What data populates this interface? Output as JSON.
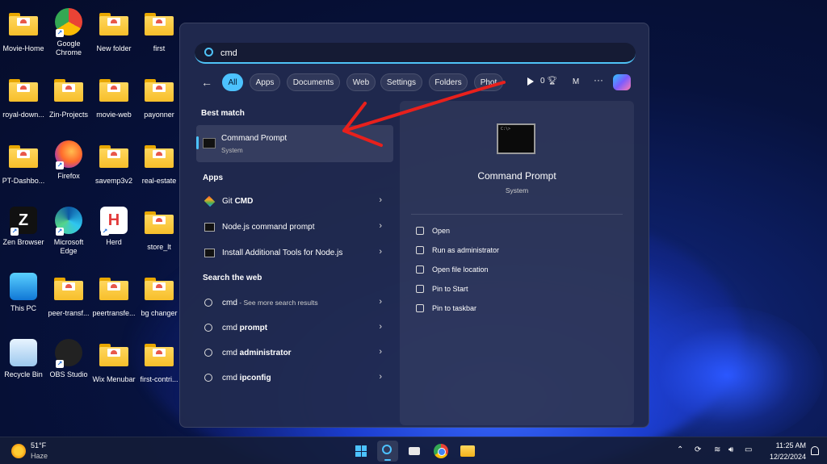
{
  "desktop": {
    "icons": [
      {
        "label": "Movie-Home",
        "type": "folder"
      },
      {
        "label": "Google Chrome",
        "type": "chrome"
      },
      {
        "label": "New folder",
        "type": "folder"
      },
      {
        "label": "first",
        "type": "folder"
      },
      {
        "label": "royal-down...",
        "type": "folder"
      },
      {
        "label": "Zin-Projects",
        "type": "folder"
      },
      {
        "label": "movie-web",
        "type": "folder"
      },
      {
        "label": "payonner",
        "type": "folder"
      },
      {
        "label": "PT-Dashbo...",
        "type": "folder"
      },
      {
        "label": "Firefox",
        "type": "firefox"
      },
      {
        "label": "savemp3v2",
        "type": "folder"
      },
      {
        "label": "real-estate",
        "type": "folder"
      },
      {
        "label": "Zen Browser",
        "type": "zen"
      },
      {
        "label": "Microsoft Edge",
        "type": "edge"
      },
      {
        "label": "Herd",
        "type": "herd"
      },
      {
        "label": "store_lt",
        "type": "folder"
      },
      {
        "label": "This PC",
        "type": "pc"
      },
      {
        "label": "peer-transf...",
        "type": "folder"
      },
      {
        "label": "peertransfe...",
        "type": "folder"
      },
      {
        "label": "bg changer",
        "type": "folder"
      },
      {
        "label": "Recycle Bin",
        "type": "recycle"
      },
      {
        "label": "OBS Studio",
        "type": "obs"
      },
      {
        "label": "Wix Menubar",
        "type": "folder"
      },
      {
        "label": "first-contri...",
        "type": "folder"
      }
    ]
  },
  "search": {
    "query": "cmd",
    "filters": [
      "All",
      "Apps",
      "Documents",
      "Web",
      "Settings",
      "Folders",
      "Phot"
    ],
    "active_filter": "All",
    "points": "0",
    "avatar_initial": "M",
    "more": "···"
  },
  "results": {
    "best_match_title": "Best match",
    "best_match": {
      "title": "Command Prompt",
      "subtitle": "System"
    },
    "apps_title": "Apps",
    "apps": [
      {
        "label": "Git ",
        "bold": "CMD",
        "icon": "git-icon"
      },
      {
        "label": "Node.js command prompt",
        "bold": "",
        "icon": "terminal-icon"
      },
      {
        "label": "Install Additional Tools for Node.js",
        "bold": "",
        "icon": "terminal-icon"
      }
    ],
    "web_title": "Search the web",
    "web": [
      {
        "label": "cmd",
        "muted": " - See more search results"
      },
      {
        "label": "cmd ",
        "bold": "prompt"
      },
      {
        "label": "cmd ",
        "bold": "administrator"
      },
      {
        "label": "cmd ",
        "bold": "ipconfig"
      }
    ]
  },
  "preview": {
    "title": "Command Prompt",
    "subtitle": "System",
    "actions": [
      {
        "label": "Open",
        "icon": "open-icon"
      },
      {
        "label": "Run as administrator",
        "icon": "shield-icon"
      },
      {
        "label": "Open file location",
        "icon": "folder-icon"
      },
      {
        "label": "Pin to Start",
        "icon": "pin-icon"
      },
      {
        "label": "Pin to taskbar",
        "icon": "pin-icon"
      }
    ]
  },
  "taskbar": {
    "weather_temp": "51°F",
    "weather_desc": "Haze",
    "time": "11:25 AM",
    "date": "12/22/2024"
  },
  "colors": {
    "accent": "#4cc2ff",
    "annotation": "#e8201c"
  }
}
